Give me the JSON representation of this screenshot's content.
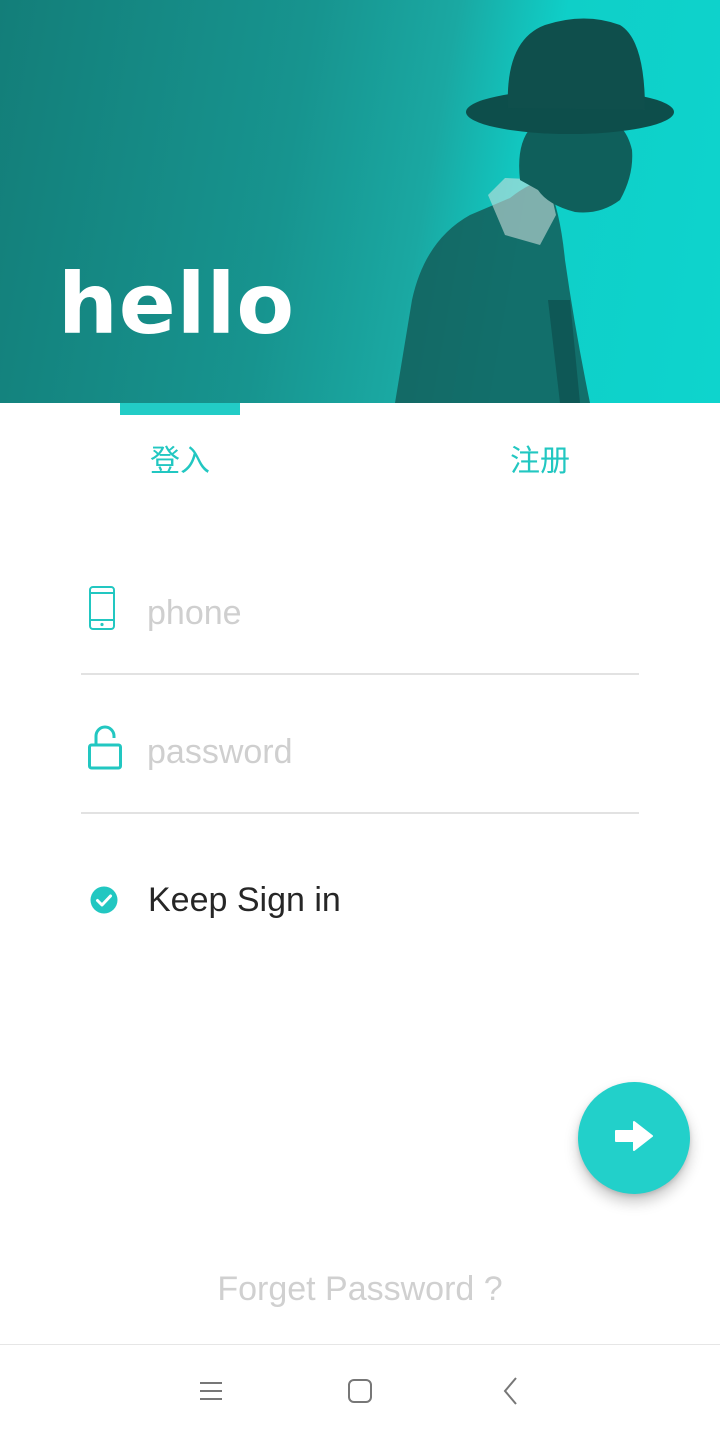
{
  "hero": {
    "title": "hello"
  },
  "tabs": {
    "login": "登入",
    "register": "注册"
  },
  "form": {
    "phone_placeholder": "phone",
    "password_placeholder": "password",
    "keep_signin_label": "Keep Sign in",
    "keep_signin_checked": true
  },
  "icons": {
    "phone": "phone-icon",
    "password": "unlock-icon",
    "keep": "check-circle-icon",
    "submit": "arrow-right-icon",
    "nav_menu": "menu-icon",
    "nav_home": "home-square-icon",
    "nav_back": "back-chevron-icon"
  },
  "forget_password": "Forget Password ?",
  "colors": {
    "accent": "#22ccc6",
    "hero_dark": "#137e79",
    "hero_light": "#0ed4cd"
  }
}
